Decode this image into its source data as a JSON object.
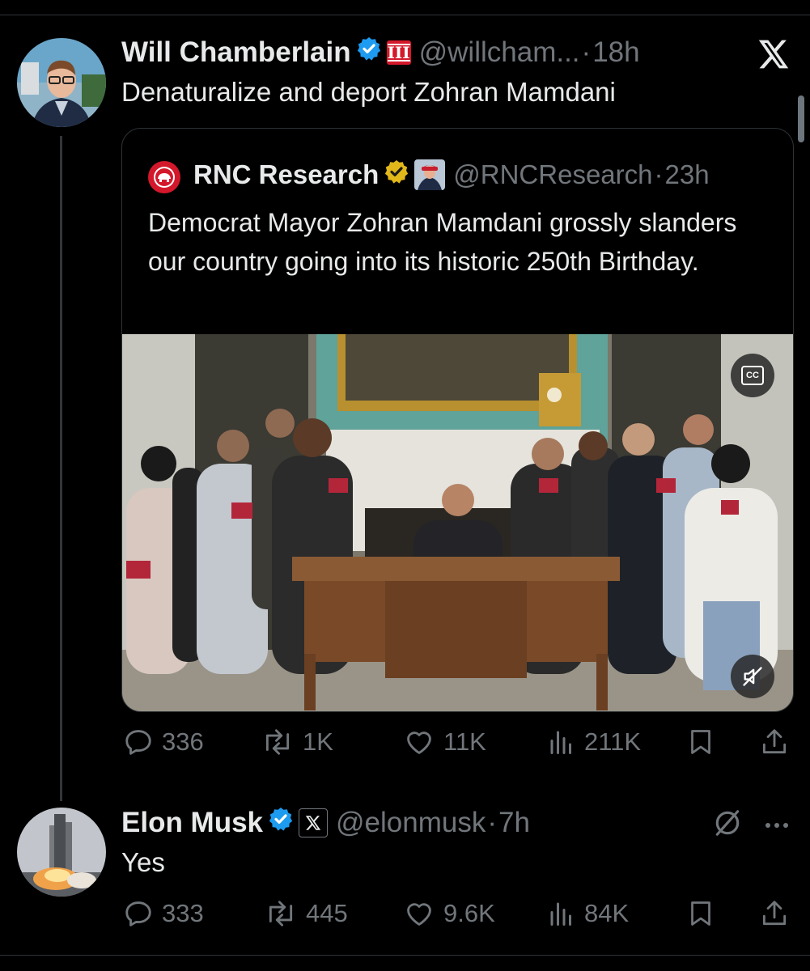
{
  "post": {
    "author_name": "Will Chamberlain",
    "handle": "@willcham...",
    "separator": "·",
    "time": "18h",
    "badge_label": "III",
    "text": "Denaturalize and deport Zohran Mamdani",
    "stats": {
      "replies": "336",
      "reposts": "1K",
      "likes": "11K",
      "views": "211K"
    }
  },
  "quoted": {
    "author_name": "RNC Research",
    "handle": "@RNCResearch",
    "separator": "·",
    "time": "23h",
    "text": "Democrat Mayor Zohran Mamdani grossly slanders our country going into its historic 250th Birthday.",
    "media_badge": "CC"
  },
  "reply": {
    "author_name": "Elon Musk",
    "handle": "@elonmusk",
    "separator": "·",
    "time": "7h",
    "text": "Yes",
    "stats": {
      "replies": "333",
      "reposts": "445",
      "likes": "9.6K",
      "views": "84K"
    }
  },
  "icons": {
    "close": "x-logo-icon",
    "reply": "reply-icon",
    "repost": "repost-icon",
    "like": "heart-icon",
    "views": "views-icon",
    "bookmark": "bookmark-icon",
    "share": "share-icon",
    "verified": "verified-badge-icon",
    "grok": "grok-icon",
    "more": "more-icon",
    "mute": "mute-icon",
    "captions": "captions-icon"
  },
  "colors": {
    "background": "#000000",
    "text": "#e7e9ea",
    "secondary": "#71767b",
    "verified_blue": "#1d9bf0",
    "verified_gold": "#e2b719",
    "border": "#2f3336"
  }
}
